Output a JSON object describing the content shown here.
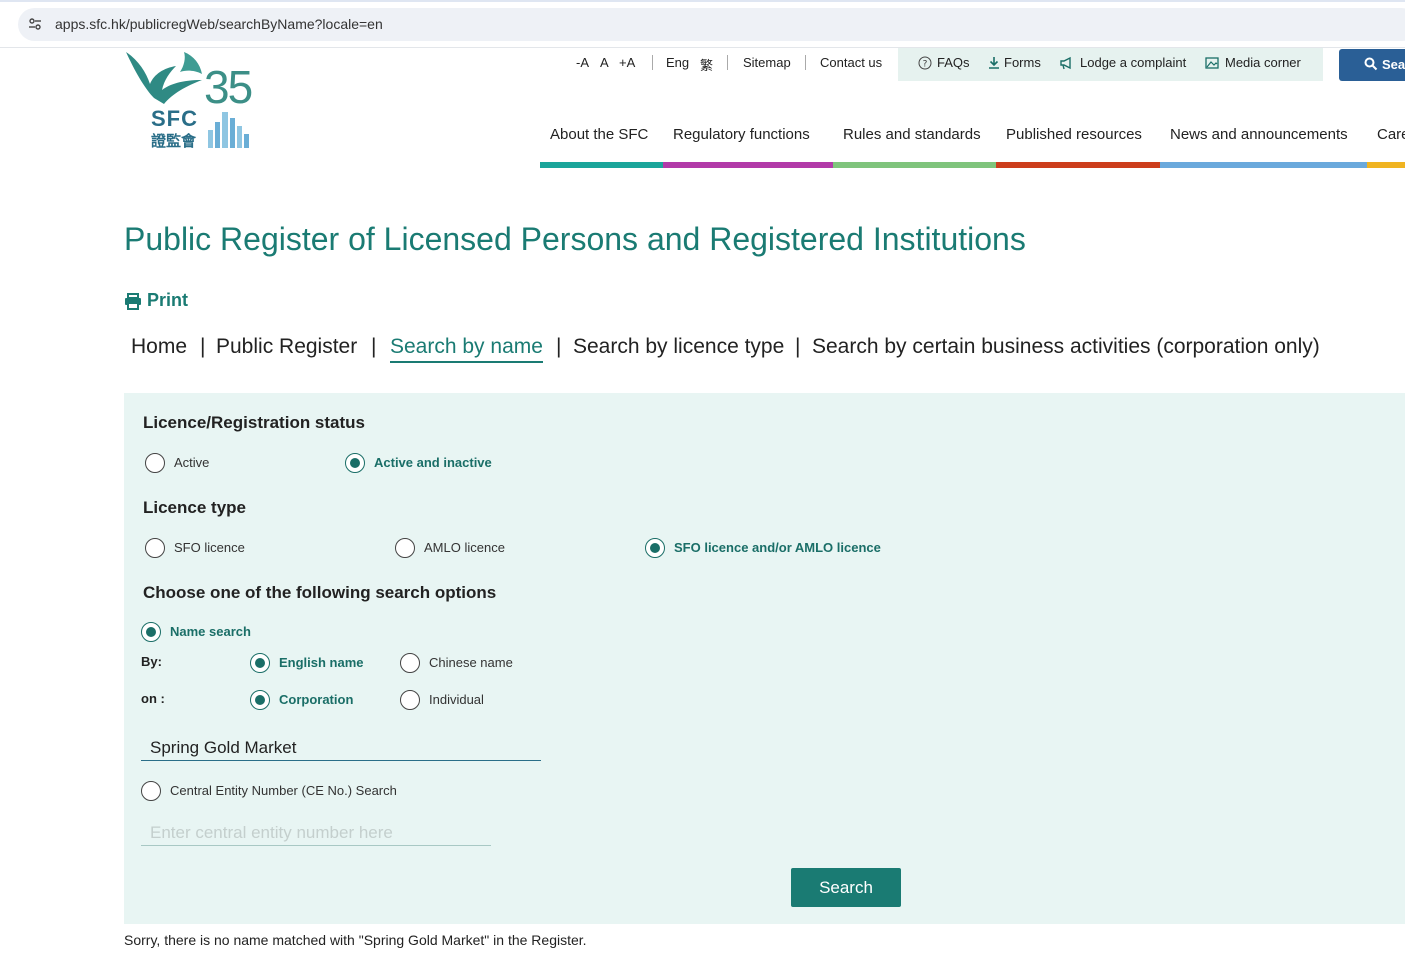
{
  "browser": {
    "url": "apps.sfc.hk/publicregWeb/searchByName?locale=en"
  },
  "logo": {
    "text": "SFC",
    "number": "35",
    "chinese": "證監會"
  },
  "utility": {
    "font_smaller": "-A",
    "font_normal": "A",
    "font_larger": "+A",
    "lang_en": "Eng",
    "lang_zh": "繁",
    "sitemap": "Sitemap",
    "contact": "Contact us",
    "faqs": "FAQs",
    "forms": "Forms",
    "complaint": "Lodge a complaint",
    "media": "Media corner",
    "search": "Sear"
  },
  "nav": {
    "items": [
      {
        "label": "About the SFC",
        "color": "#1aa59a"
      },
      {
        "label": "Regulatory functions",
        "color": "#b23aa8"
      },
      {
        "label": "Rules and standards",
        "color": "#7fc47c"
      },
      {
        "label": "Published resources",
        "color": "#cc3d1c"
      },
      {
        "label": "News and announcements",
        "color": "#6aa9dc"
      },
      {
        "label": "Care",
        "color": "#f0b421"
      }
    ]
  },
  "page": {
    "title": "Public Register of Licensed Persons and Registered Institutions",
    "print": "Print"
  },
  "breadcrumb": {
    "home": "Home",
    "public_register": "Public Register",
    "search_by_name": "Search by name",
    "search_by_licence": "Search by licence type",
    "search_by_activity": "Search by certain business activities (corporation only)",
    "separator": "|"
  },
  "form": {
    "status": {
      "heading": "Licence/Registration status",
      "options": [
        "Active",
        "Active and inactive"
      ],
      "selected": "Active and inactive"
    },
    "licence_type": {
      "heading": "Licence type",
      "options": [
        "SFO licence",
        "AMLO licence",
        "SFO licence and/or AMLO licence"
      ],
      "selected": "SFO licence and/or AMLO licence"
    },
    "search_options": {
      "heading": "Choose one of the following search options",
      "name_search": "Name search",
      "by_label": "By:",
      "by_options": [
        "English name",
        "Chinese name"
      ],
      "on_label": "on :",
      "on_options": [
        "Corporation",
        "Individual"
      ],
      "name_value": "Spring Gold Market",
      "ce_search": "Central Entity Number (CE No.) Search",
      "ce_placeholder": "Enter central entity number here"
    },
    "search_button": "Search"
  },
  "result": {
    "message": "Sorry, there is no name matched with \"Spring Gold Market\" in the Register."
  },
  "colors": {
    "brand_teal": "#1a7b73",
    "panel_bg": "#e8f5f3",
    "search_blue": "#2a5f96"
  }
}
